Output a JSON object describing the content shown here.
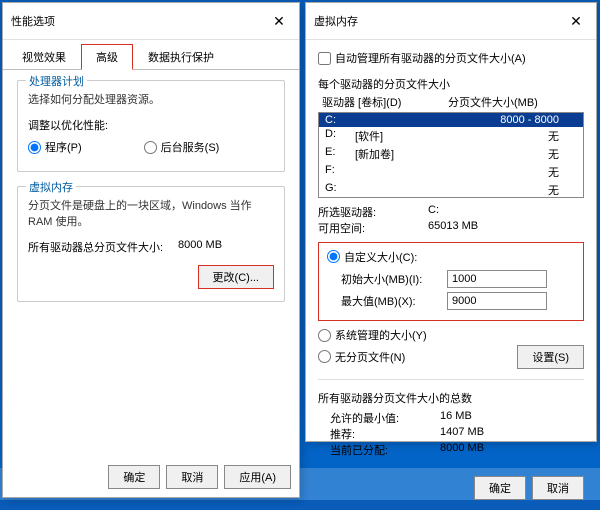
{
  "left": {
    "title": "性能选项",
    "tabs": {
      "visual": "视觉效果",
      "advanced": "高级",
      "dep": "数据执行保护"
    },
    "cpu": {
      "group": "处理器计划",
      "desc": "选择如何分配处理器资源。",
      "adjust": "调整以优化性能:",
      "programs": "程序(P)",
      "services": "后台服务(S)"
    },
    "vm": {
      "group": "虚拟内存",
      "desc": "分页文件是硬盘上的一块区域，Windows 当作 RAM 使用。",
      "total_label": "所有驱动器总分页文件大小:",
      "total_value": "8000 MB",
      "change_btn": "更改(C)..."
    },
    "buttons": {
      "ok": "确定",
      "cancel": "取消",
      "apply": "应用(A)"
    }
  },
  "right": {
    "title": "虚拟内存",
    "auto": "自动管理所有驱动器的分页文件大小(A)",
    "per_drive_label": "每个驱动器的分页文件大小",
    "header": {
      "drive": "驱动器 [卷标](D)",
      "size": "分页文件大小(MB)"
    },
    "drives": [
      {
        "letter": "C:",
        "label": "",
        "size": "8000 - 8000"
      },
      {
        "letter": "D:",
        "label": "[软件]",
        "size": "无"
      },
      {
        "letter": "E:",
        "label": "[新加卷]",
        "size": "无"
      },
      {
        "letter": "F:",
        "label": "",
        "size": "无"
      },
      {
        "letter": "G:",
        "label": "",
        "size": "无"
      }
    ],
    "selected": {
      "drive_lbl": "所选驱动器:",
      "drive_val": "C:",
      "avail_lbl": "可用空间:",
      "avail_val": "65013 MB"
    },
    "custom": {
      "radio": "自定义大小(C):",
      "init_lbl": "初始大小(MB)(I):",
      "init_val": "1000",
      "max_lbl": "最大值(MB)(X):",
      "max_val": "9000"
    },
    "system": "系统管理的大小(Y)",
    "none": "无分页文件(N)",
    "set_btn": "设置(S)",
    "totals": {
      "heading": "所有驱动器分页文件大小的总数",
      "min_lbl": "允许的最小值:",
      "min_val": "16 MB",
      "rec_lbl": "推荐:",
      "rec_val": "1407 MB",
      "cur_lbl": "当前已分配:",
      "cur_val": "8000 MB"
    },
    "buttons": {
      "ok": "确定",
      "cancel": "取消"
    }
  }
}
